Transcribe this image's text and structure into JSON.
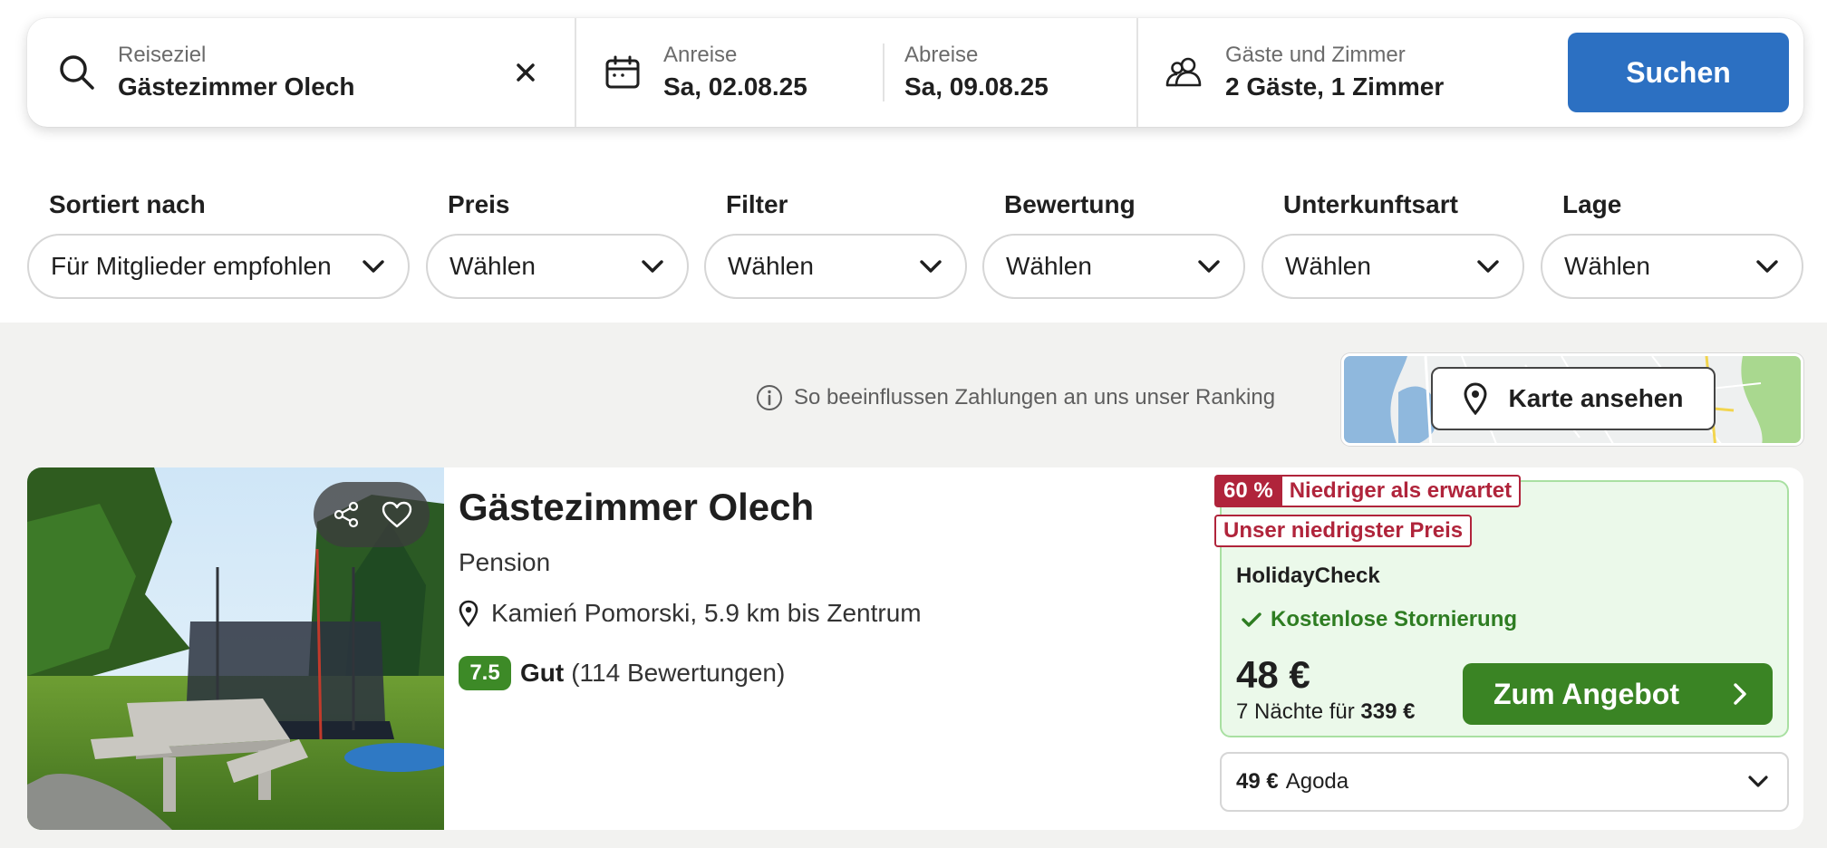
{
  "search": {
    "destination_label": "Reiseziel",
    "destination_value": "Gästezimmer Olech",
    "checkin_label": "Anreise",
    "checkin_value": "Sa, 02.08.25",
    "checkout_label": "Abreise",
    "checkout_value": "Sa, 09.08.25",
    "guests_label": "Gäste und Zimmer",
    "guests_value": "2 Gäste, 1 Zimmer",
    "search_button": "Suchen",
    "icons": [
      "search-icon",
      "close-icon",
      "calendar-icon",
      "people-icon"
    ]
  },
  "filters": [
    {
      "label": "Sortiert nach",
      "value": "Für Mitglieder empfohlen"
    },
    {
      "label": "Preis",
      "value": "Wählen"
    },
    {
      "label": "Filter",
      "value": "Wählen"
    },
    {
      "label": "Bewertung",
      "value": "Wählen"
    },
    {
      "label": "Unterkunftsart",
      "value": "Wählen"
    },
    {
      "label": "Lage",
      "value": "Wählen"
    }
  ],
  "results": {
    "ranking_note": "So beeinflussen Zahlungen an uns unser Ranking",
    "map_button": "Karte ansehen"
  },
  "hotel": {
    "name": "Gästezimmer Olech",
    "type": "Pension",
    "location": "Kamień Pomorski, 5.9 km bis Zentrum",
    "score": "7.5",
    "rating_word": "Gut",
    "reviews": "(114 Bewertungen)",
    "deal": {
      "discount_pct": "60 %",
      "discount_text": "Niedriger als erwartet",
      "lowest_price_badge": "Unser niedrigster Preis",
      "provider": "HolidayCheck",
      "cancellation": "Kostenlose Stornierung",
      "price": "48 €",
      "total_prefix": "7 Nächte für",
      "total_amount": "339 €",
      "offer_button": "Zum Angebot"
    },
    "other_offer": {
      "price": "49 €",
      "provider": "Agoda"
    }
  },
  "colors": {
    "primary_blue": "#2c70c2",
    "offer_green": "#3a8424",
    "score_green": "#3d8a27",
    "deal_bg": "#ebf9ea",
    "badge_red": "#b0243b"
  }
}
